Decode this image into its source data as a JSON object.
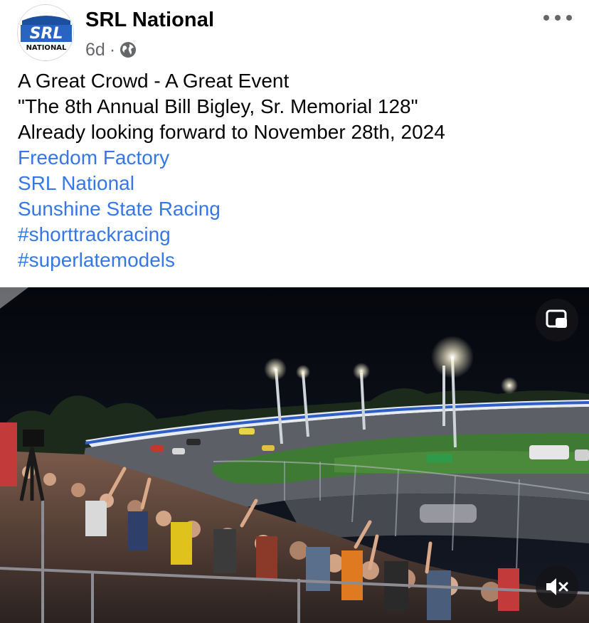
{
  "post": {
    "page_name": "SRL National",
    "timestamp": "6d",
    "separator": "·",
    "audience_icon": "globe-icon",
    "menu_icon": "more-horizontal-icon",
    "avatar": {
      "logo_text": "SRL",
      "logo_subtext": "NATIONAL"
    },
    "lines": [
      "A Great Crowd - A Great Event",
      "\"The 8th Annual Bill Bigley, Sr. Memorial 128\"",
      "Already looking forward to November 28th, 2024"
    ],
    "links": [
      "Freedom Factory",
      "SRL National",
      "Sunshine State Racing",
      "#shorttrackracing",
      "#superlatemodels"
    ]
  },
  "video": {
    "pip_icon": "picture-in-picture-icon",
    "mute_icon": "muted-speaker-icon"
  },
  "colors": {
    "link": "#3578e5",
    "text": "#050505",
    "secondary": "#65676b",
    "logo_blue": "#1b4fa0"
  }
}
